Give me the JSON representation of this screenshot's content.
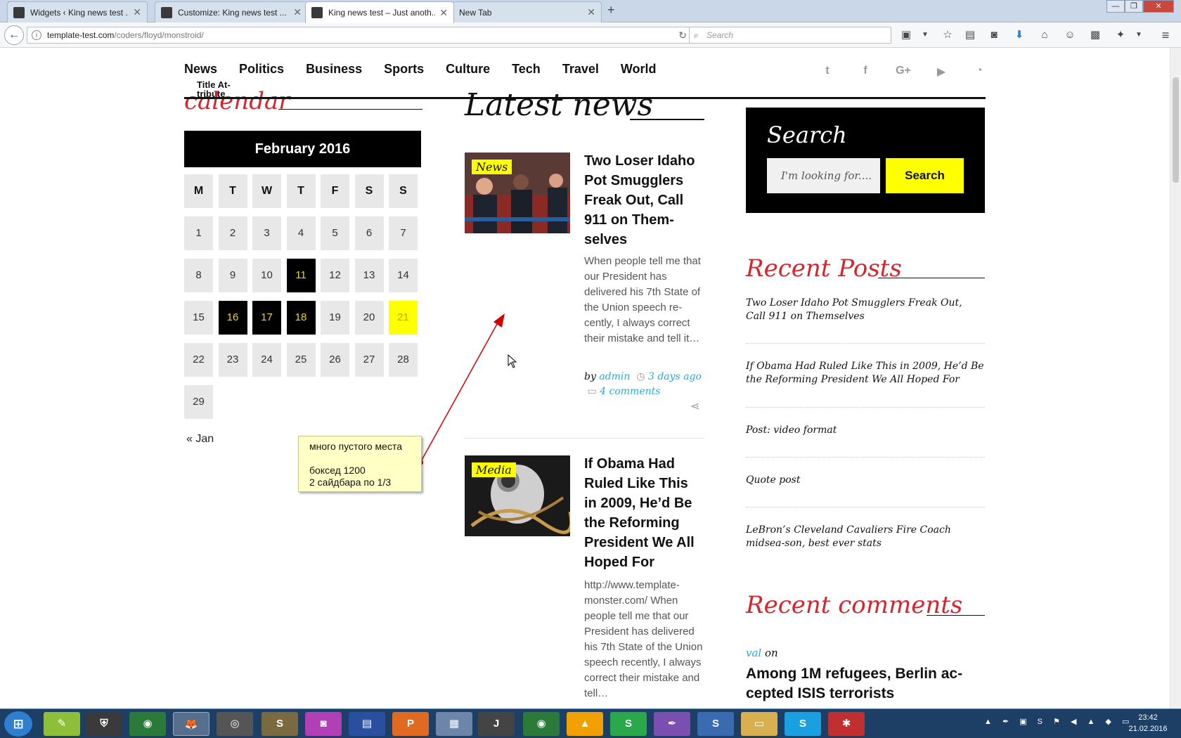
{
  "browser": {
    "tabs": [
      {
        "label": "Widgets ‹ King news test ...",
        "active": false
      },
      {
        "label": "Customize: King news test ...",
        "active": false
      },
      {
        "label": "King news test – Just anoth...",
        "active": true
      },
      {
        "label": "New Tab",
        "active": false
      }
    ],
    "new_tab": "+",
    "url_host": "template-test.com",
    "url_path": "/coders/floyd/monstroid/",
    "search_placeholder": "Search",
    "toolbar_icons": [
      "screenshot-icon",
      "dropdown-icon",
      "bookmark-star-icon",
      "reading-list-icon",
      "pocket-icon",
      "download-icon",
      "home-icon",
      "chat-icon",
      "addon-icon",
      "addon-icon-2",
      "dropdown-icon-2",
      "menu-icon"
    ]
  },
  "site": {
    "nav": [
      "News",
      "Politics",
      "Business",
      "Sports",
      "Culture",
      "Tech",
      "Travel",
      "World"
    ],
    "title_attribute": "Title At-tribute",
    "social": [
      "twitter-icon",
      "facebook-icon",
      "google-plus-icon",
      "youtube-icon",
      "rss-icon"
    ]
  },
  "calendar": {
    "title": "calendar",
    "month": "February 2016",
    "weekdays": [
      "M",
      "T",
      "W",
      "T",
      "F",
      "S",
      "S"
    ],
    "days": [
      "1",
      "2",
      "3",
      "4",
      "5",
      "6",
      "7",
      "8",
      "9",
      "10",
      "11",
      "12",
      "13",
      "14",
      "15",
      "16",
      "17",
      "18",
      "19",
      "20",
      "21",
      "22",
      "23",
      "24",
      "25",
      "26",
      "27",
      "28",
      "29"
    ],
    "event_days": [
      "11",
      "16",
      "17",
      "18"
    ],
    "today": "21",
    "prev_link": "« Jan"
  },
  "latest_news": {
    "title": "Latest news",
    "posts": [
      {
        "category": "News",
        "title": "Two Loser Idaho Pot Smugglers Freak Out, Call 911 on Them-selves",
        "excerpt": "When people tell me that our President has delivered his 7th State of the Union speech re-cently, I always correct their mistake and tell it…",
        "by": "by",
        "author": "admin",
        "time": "3 days ago",
        "comments": "4 comments"
      },
      {
        "category": "Media",
        "title": "If Obama Had Ruled Like This in 2009, He’d Be the Reforming President We All Hoped For",
        "excerpt": "http://www.template-monster.com/ When people tell me that our President has delivered his 7th State of the Union speech recently, I always correct their mistake and tell…"
      }
    ]
  },
  "sidebar": {
    "search_title": "Search",
    "search_placeholder": "I'm looking for....",
    "search_button": "Search",
    "recent_posts_title": "Recent Posts",
    "recent_posts": [
      "Two Loser Idaho Pot Smugglers Freak Out, Call 911 on Themselves",
      "If Obama Had Ruled Like This in 2009, He’d Be the Reforming President We All Hoped For",
      "Post: video format",
      "Quote post",
      "LeBron’s Cleveland Cavaliers Fire Coach midsea-son, best ever stats"
    ],
    "recent_comments_title": "Recent comments",
    "comment_author": "val",
    "comment_on": "on",
    "comment_post": "Among 1M refugees, Berlin ac-cepted ISIS terrorists"
  },
  "annotation": {
    "line1": "много пустого места",
    "line2": "боксед 1200",
    "line3": "2 сайдбара по 1/3",
    "color": "#d40000"
  },
  "taskbar": {
    "start": "start-icon",
    "apps": [
      "notepad-icon",
      "tanks-icon",
      "chrome-icon",
      "firefox-icon",
      "owl-icon",
      "sublime-icon",
      "media-icon",
      "filezilla-icon",
      "pdf-icon",
      "calculator-icon",
      "intellij-icon",
      "chrome-icon-2",
      "avast-icon",
      "s-app-icon",
      "quill-icon",
      "skype-alt-icon",
      "explorer-icon",
      "skype-icon",
      "game-icon"
    ],
    "time": "23:42",
    "date": "21.02.2016"
  }
}
